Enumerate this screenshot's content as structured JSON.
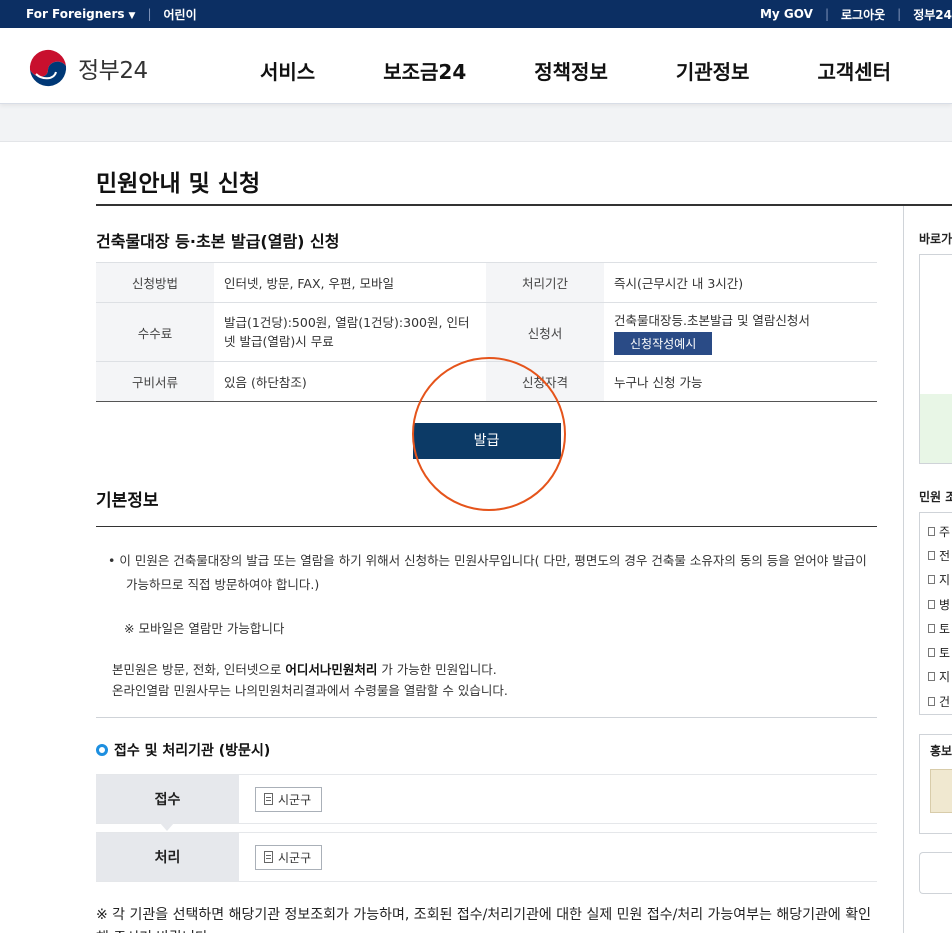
{
  "topbar": {
    "foreigners": "For Foreigners",
    "kids": "어린이",
    "mygov": "My GOV",
    "logout": "로그아웃",
    "gov24_short": "정부24"
  },
  "header": {
    "logo_text": "정부24",
    "nav": [
      "서비스",
      "보조금24",
      "정책정보",
      "기관정보",
      "고객센터"
    ]
  },
  "page": {
    "title": "민원안내 및 신청"
  },
  "application": {
    "title": "건축물대장 등·초본 발급(열람) 신청",
    "rows": [
      {
        "label1": "신청방법",
        "value1": "인터넷, 방문, FAX, 우편, 모바일",
        "label2": "처리기간",
        "value2": "즉시(근무시간 내 3시간)"
      },
      {
        "label1": "수수료",
        "value1": "발급(1건당):500원, 열람(1건당):300원, 인터넷 발급(열람)시 무료",
        "label2": "신청서",
        "value2": "건축물대장등.초본발급 및 열람신청서",
        "button2": "신청작성예시"
      },
      {
        "label1": "구비서류",
        "value1": "있음 (하단참조)",
        "label2": "신청자격",
        "value2": "누구나 신청 가능"
      }
    ],
    "issue_button": "발급"
  },
  "basic_info": {
    "title": "기본정보",
    "bullet": "이 민원은 건축물대장의 발급 또는 열람을 하기 위해서 신청하는 민원사무입니다( 다만, 평면도의 경우 건축물 소유자의 동의 등을 얻어야 발급이 가능하므로 직접 방문하여야 합니다.)",
    "note": "※ 모바일은 열람만 가능합니다",
    "para1_pre": "본민원은 방문, 전화, 인터넷으로 ",
    "para1_bold": "어디서나민원처리",
    "para1_post": " 가 가능한 민원입니다.",
    "para2": "온라인열람 민원사무는 나의민원처리결과에서 수령물을 열람할 수 있습니다."
  },
  "agency": {
    "title": "접수 및 처리기관 (방문시)",
    "receive_label": "접수",
    "receive_value": "시군구",
    "process_label": "처리",
    "process_value": "시군구"
  },
  "footnote": "※ 각 기관을 선택하면 해당기관 정보조회가 가능하며, 조회된 접수/처리기관에 대한 실제 민원 접수/처리 가능여부는 해당기관에 확인해 주시기 바랍니다.",
  "sidebar": {
    "shortcut_title": "바로가기",
    "civil_title": "민원 조회",
    "list_items": [
      "주",
      "전",
      "지",
      "병",
      "토",
      "토",
      "지",
      "건"
    ],
    "promo_title": "홍보"
  },
  "colors": {
    "topbar": "#0c2f63",
    "issue_button": "#0c3a66",
    "sample_button": "#2a4b86",
    "highlight_circle": "#e5541b"
  }
}
